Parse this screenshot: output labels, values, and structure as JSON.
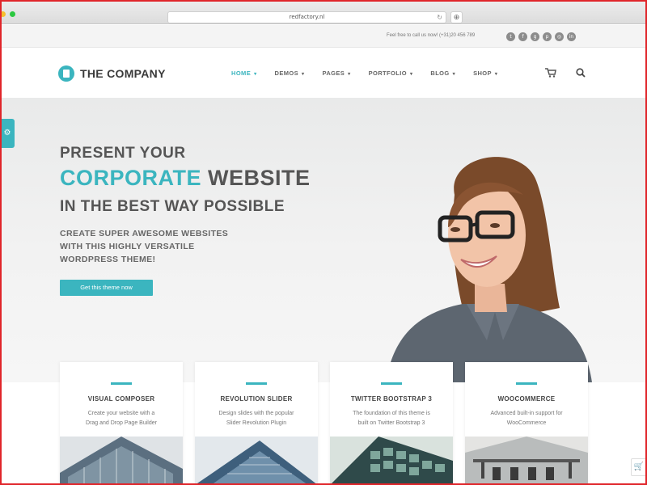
{
  "browser": {
    "url": "redfactory.nl",
    "reload_glyph": "↻",
    "newtab_glyph": "⊕"
  },
  "topbar": {
    "call_text": "Feel free to call us now! (+31)20 456 789",
    "social_icons": [
      "twitter-icon",
      "facebook-icon",
      "googleplus-icon",
      "pinterest-icon",
      "instagram-icon",
      "linkedin-icon"
    ]
  },
  "header": {
    "logo_text": "THE COMPANY",
    "nav": [
      {
        "label": "HOME",
        "active": true
      },
      {
        "label": "DEMOS",
        "active": false
      },
      {
        "label": "PAGES",
        "active": false
      },
      {
        "label": "PORTFOLIO",
        "active": false
      },
      {
        "label": "BLOG",
        "active": false
      },
      {
        "label": "SHOP",
        "active": false
      }
    ],
    "chevron": "▾"
  },
  "hero": {
    "line1": "PRESENT YOUR",
    "line2_accent": "CORPORATE",
    "line2_rest": " WEBSITE",
    "line3": "IN THE BEST WAY POSSIBLE",
    "sub1": "CREATE SUPER AWESOME WEBSITES",
    "sub2": "WITH THIS HIGHLY VERSATILE",
    "sub3": "WORDPRESS THEME!",
    "cta": "Get this theme now"
  },
  "cards": [
    {
      "title": "VISUAL COMPOSER",
      "desc1": "Create your website with a",
      "desc2": "Drag and Drop Page Builder"
    },
    {
      "title": "REVOLUTION SLIDER",
      "desc1": "Design slides with the popular",
      "desc2": "Slider Revolution Plugin"
    },
    {
      "title": "TWITTER BOOTSTRAP 3",
      "desc1": "The foundation of this theme is",
      "desc2": "built on Twitter Bootstrap 3"
    },
    {
      "title": "WOOCOMMERCE",
      "desc1": "Advanced built-in support for",
      "desc2": "WooCommerce"
    }
  ],
  "colors": {
    "accent": "#3bb5bf",
    "frame_border": "#e0252a",
    "heading": "#555555"
  }
}
